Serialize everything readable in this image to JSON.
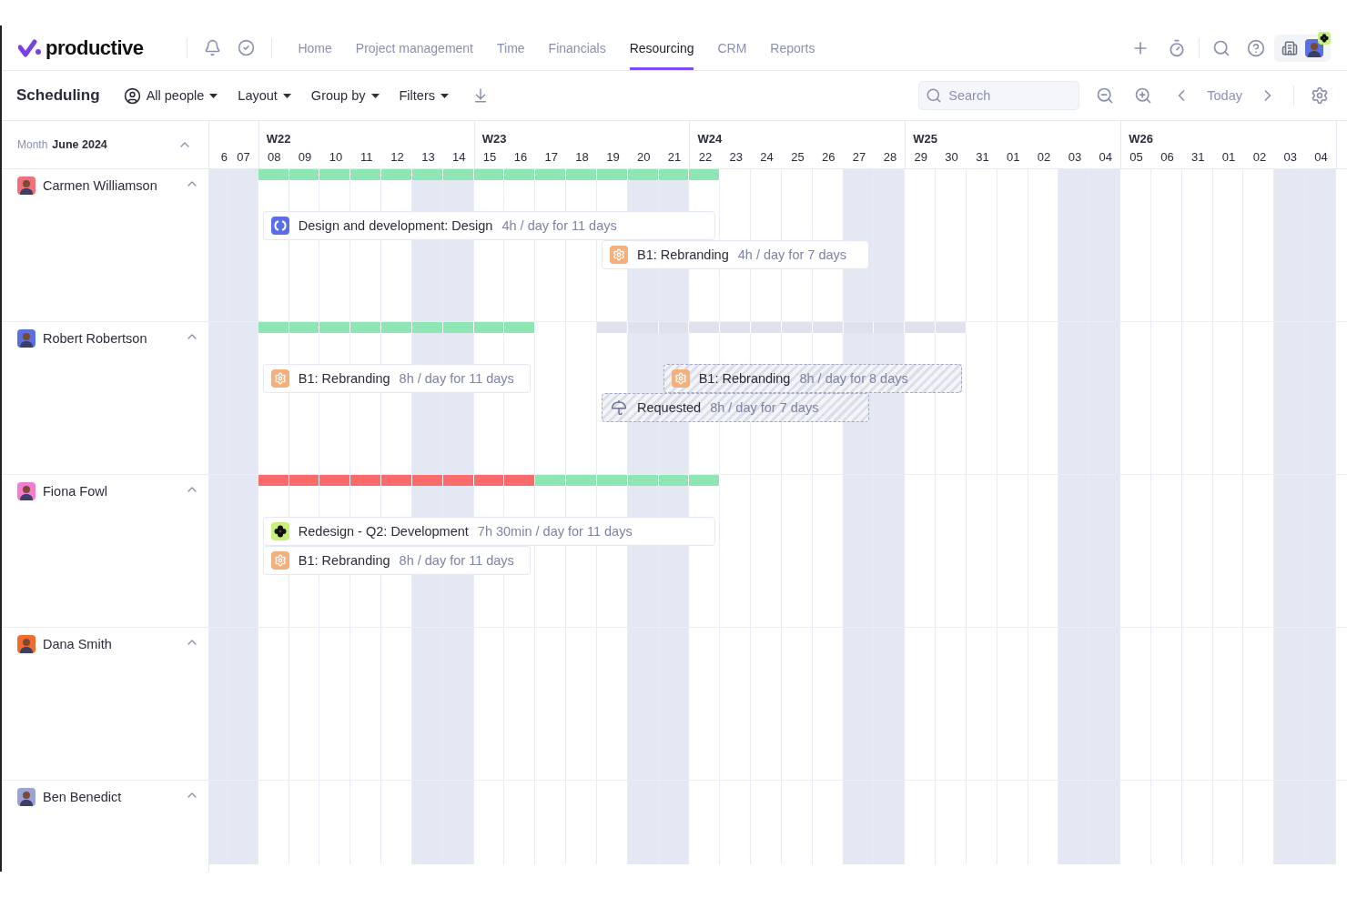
{
  "nav": {
    "logo": "productive",
    "links": [
      {
        "label": "Home",
        "selected": false
      },
      {
        "label": "Project management",
        "selected": false
      },
      {
        "label": "Time",
        "selected": false
      },
      {
        "label": "Financials",
        "selected": false
      },
      {
        "label": "Resourcing",
        "selected": true
      },
      {
        "label": "CRM",
        "selected": false
      },
      {
        "label": "Reports",
        "selected": false
      }
    ]
  },
  "toolbar": {
    "title": "Scheduling",
    "menus": [
      "All people",
      "Layout",
      "Group by",
      "Filters"
    ],
    "search": {
      "placeholder": "Search"
    },
    "today": "Today"
  },
  "timeline": {
    "month_label": "Month",
    "month": "June 2024",
    "expanded": true,
    "days": [
      {
        "label": "6",
        "weekend": true
      },
      {
        "label": "07",
        "weekend": true
      },
      {
        "label": "08",
        "week": "W22",
        "weekend": false
      },
      {
        "label": "09",
        "weekend": false
      },
      {
        "label": "10",
        "weekend": false
      },
      {
        "label": "11",
        "weekend": false
      },
      {
        "label": "12",
        "weekend": false
      },
      {
        "label": "13",
        "weekend": true
      },
      {
        "label": "14",
        "weekend": true
      },
      {
        "label": "15",
        "week": "W23",
        "weekend": false
      },
      {
        "label": "16",
        "weekend": false
      },
      {
        "label": "17",
        "weekend": false
      },
      {
        "label": "18",
        "weekend": false
      },
      {
        "label": "19",
        "weekend": false
      },
      {
        "label": "20",
        "weekend": true
      },
      {
        "label": "21",
        "weekend": true
      },
      {
        "label": "22",
        "week": "W24",
        "weekend": false
      },
      {
        "label": "23",
        "weekend": false
      },
      {
        "label": "24",
        "weekend": false
      },
      {
        "label": "25",
        "weekend": false
      },
      {
        "label": "26",
        "weekend": false
      },
      {
        "label": "27",
        "weekend": true
      },
      {
        "label": "28",
        "weekend": true
      },
      {
        "label": "29",
        "week": "W25",
        "weekend": false
      },
      {
        "label": "30",
        "weekend": false
      },
      {
        "label": "31",
        "weekend": false
      },
      {
        "label": "01",
        "weekend": false
      },
      {
        "label": "02",
        "weekend": false
      },
      {
        "label": "03",
        "weekend": true
      },
      {
        "label": "04",
        "weekend": true
      },
      {
        "label": "05",
        "week": "W26",
        "weekend": false
      },
      {
        "label": "06",
        "weekend": false
      },
      {
        "label": "31",
        "weekend": false
      },
      {
        "label": "01",
        "weekend": false
      },
      {
        "label": "02",
        "weekend": false
      },
      {
        "label": "03",
        "weekend": true
      },
      {
        "label": "04",
        "weekend": true
      }
    ]
  },
  "people": [
    {
      "name": "Carmen Williamson",
      "color": "#f0707c",
      "expanded": true,
      "capacity": [
        {
          "kind": "booked"
        }
      ],
      "bookings": [
        {
          "title": "Design and development: Design",
          "detail": "4h / day for 11 days",
          "kind": "project"
        },
        {
          "title": "B1: Rebranding",
          "detail": "4h / day for 7 days",
          "kind": "budget"
        }
      ]
    },
    {
      "name": "Robert Robertson",
      "color": "#5a6fe0",
      "expanded": true,
      "capacity": [
        {
          "kind": "booked"
        },
        {
          "kind": "timeoff"
        }
      ],
      "bookings": [
        {
          "title": "B1: Rebranding",
          "detail": "8h / day for 11 days",
          "kind": "budget"
        },
        {
          "title": "B1: Rebranding",
          "detail": "8h / day for 8 days",
          "kind": "hold"
        },
        {
          "title": "Requested",
          "detail": "8h / day for 7 days",
          "kind": "request"
        }
      ]
    },
    {
      "name": "Fiona Fowl",
      "color": "#f47bd0",
      "expanded": true,
      "capacity": [
        {
          "kind": "overbooked"
        },
        {
          "kind": "booked"
        }
      ],
      "bookings": [
        {
          "title": "Redesign - Q2: Development",
          "detail": "7h 30min / day for 11 days",
          "kind": "deal"
        },
        {
          "title": "B1: Rebranding",
          "detail": "8h / day for 11 days",
          "kind": "budget"
        }
      ]
    },
    {
      "name": "Dana Smith",
      "color": "#f26a2e",
      "expanded": true
    },
    {
      "name": "Ben Benedict",
      "color": "#9aa3d8",
      "expanded": true
    }
  ]
}
